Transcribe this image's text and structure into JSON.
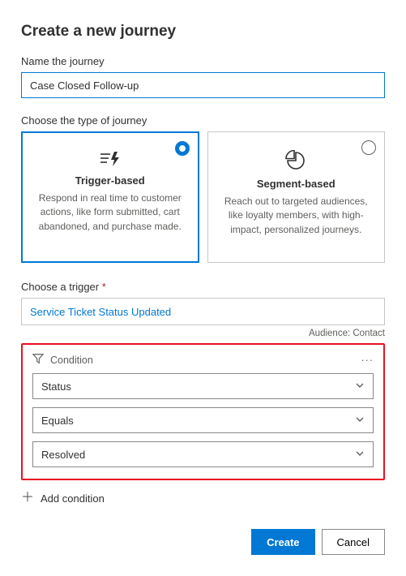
{
  "title": "Create a new journey",
  "name_field": {
    "label": "Name the journey",
    "value": "Case Closed Follow-up"
  },
  "type_section": {
    "label": "Choose the type of journey",
    "options": [
      {
        "title": "Trigger-based",
        "desc": "Respond in real time to customer actions, like form submitted, cart abandoned, and purchase made.",
        "selected": true
      },
      {
        "title": "Segment-based",
        "desc": "Reach out to targeted audiences, like loyalty members, with high-impact, personalized journeys.",
        "selected": false
      }
    ]
  },
  "trigger_section": {
    "label": "Choose a trigger ",
    "required_mark": "*",
    "value": "Service Ticket Status Updated",
    "audience_label": "Audience: Contact"
  },
  "condition": {
    "header": "Condition",
    "fields": [
      {
        "value": "Status"
      },
      {
        "value": "Equals"
      },
      {
        "value": "Resolved"
      }
    ]
  },
  "add_condition_label": "Add condition",
  "buttons": {
    "create": "Create",
    "cancel": "Cancel"
  }
}
